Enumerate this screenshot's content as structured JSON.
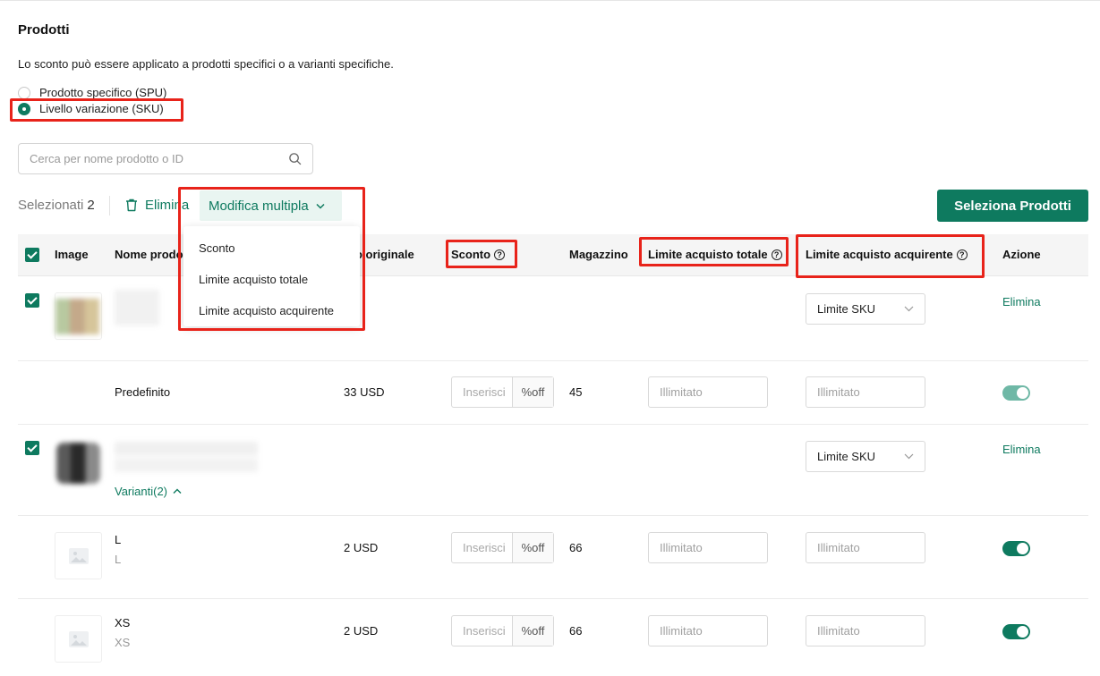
{
  "section": {
    "title": "Prodotti",
    "subtitle": "Lo sconto può essere applicato a prodotti specifici o a varianti specifiche."
  },
  "scope": {
    "options": [
      {
        "label": "Prodotto specifico (SPU)",
        "selected": false
      },
      {
        "label": "Livello variazione (SKU)",
        "selected": true
      }
    ]
  },
  "search": {
    "placeholder": "Cerca per nome prodotto o ID",
    "value": ""
  },
  "toolbar": {
    "selected_label": "Selezionati",
    "selected_count": "2",
    "delete_label": "Elimina",
    "bulk_edit_label": "Modifica multipla",
    "select_products_label": "Seleziona Prodotti"
  },
  "bulk_menu": {
    "items": [
      "Sconto",
      "Limite acquisto totale",
      "Limite acquisto acquirente"
    ]
  },
  "table": {
    "headers": {
      "image": "Image",
      "name": "Nome prodo",
      "price": "zzo originale",
      "discount": "Sconto",
      "stock": "Magazzino",
      "total_limit": "Limite acquisto totale",
      "buyer_limit": "Limite acquisto acquirente",
      "action": "Azione"
    },
    "product1": {
      "checked": true,
      "buyer_limit_select": "Limite SKU",
      "action": "Elimina",
      "variant": {
        "name": "Predefinito",
        "price": "33 USD",
        "discount_placeholder": "Inserisci",
        "discount_unit": "%off",
        "stock": "45",
        "total_limit_placeholder": "Illimitato",
        "buyer_limit_placeholder": "Illimitato",
        "enabled": true
      }
    },
    "product2": {
      "checked": true,
      "variants_toggle": "Varianti(2)",
      "buyer_limit_select": "Limite SKU",
      "action": "Elimina",
      "variants": [
        {
          "name": "L",
          "sub": "L",
          "price": "2 USD",
          "discount_placeholder": "Inserisci",
          "discount_unit": "%off",
          "stock": "66",
          "total_limit_placeholder": "Illimitato",
          "buyer_limit_placeholder": "Illimitato",
          "enabled": true
        },
        {
          "name": "XS",
          "sub": "XS",
          "price": "2 USD",
          "discount_placeholder": "Inserisci",
          "discount_unit": "%off",
          "stock": "66",
          "total_limit_placeholder": "Illimitato",
          "buyer_limit_placeholder": "Illimitato",
          "enabled": true
        }
      ]
    }
  },
  "colors": {
    "accent": "#0e7a5f",
    "highlight": "#e8231a"
  }
}
